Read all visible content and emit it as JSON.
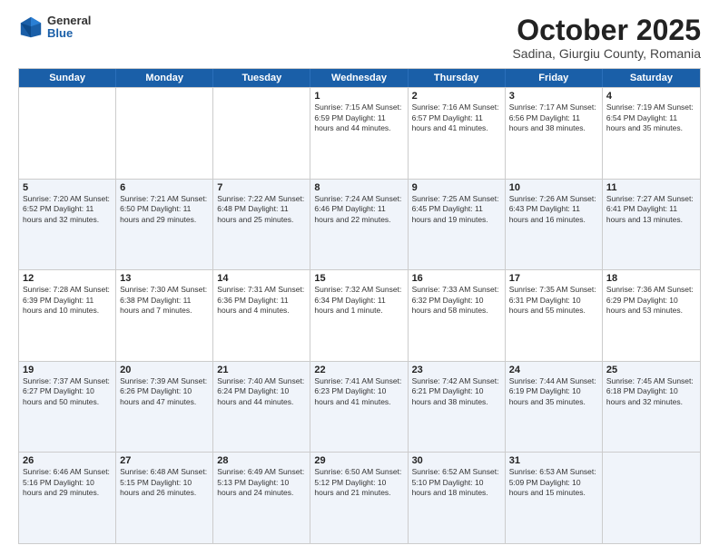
{
  "header": {
    "logo_general": "General",
    "logo_blue": "Blue",
    "month_title": "October 2025",
    "subtitle": "Sadina, Giurgiu County, Romania"
  },
  "weekdays": [
    "Sunday",
    "Monday",
    "Tuesday",
    "Wednesday",
    "Thursday",
    "Friday",
    "Saturday"
  ],
  "rows": [
    [
      {
        "day": "",
        "info": ""
      },
      {
        "day": "",
        "info": ""
      },
      {
        "day": "",
        "info": ""
      },
      {
        "day": "1",
        "info": "Sunrise: 7:15 AM\nSunset: 6:59 PM\nDaylight: 11 hours and 44 minutes."
      },
      {
        "day": "2",
        "info": "Sunrise: 7:16 AM\nSunset: 6:57 PM\nDaylight: 11 hours and 41 minutes."
      },
      {
        "day": "3",
        "info": "Sunrise: 7:17 AM\nSunset: 6:56 PM\nDaylight: 11 hours and 38 minutes."
      },
      {
        "day": "4",
        "info": "Sunrise: 7:19 AM\nSunset: 6:54 PM\nDaylight: 11 hours and 35 minutes."
      }
    ],
    [
      {
        "day": "5",
        "info": "Sunrise: 7:20 AM\nSunset: 6:52 PM\nDaylight: 11 hours and 32 minutes."
      },
      {
        "day": "6",
        "info": "Sunrise: 7:21 AM\nSunset: 6:50 PM\nDaylight: 11 hours and 29 minutes."
      },
      {
        "day": "7",
        "info": "Sunrise: 7:22 AM\nSunset: 6:48 PM\nDaylight: 11 hours and 25 minutes."
      },
      {
        "day": "8",
        "info": "Sunrise: 7:24 AM\nSunset: 6:46 PM\nDaylight: 11 hours and 22 minutes."
      },
      {
        "day": "9",
        "info": "Sunrise: 7:25 AM\nSunset: 6:45 PM\nDaylight: 11 hours and 19 minutes."
      },
      {
        "day": "10",
        "info": "Sunrise: 7:26 AM\nSunset: 6:43 PM\nDaylight: 11 hours and 16 minutes."
      },
      {
        "day": "11",
        "info": "Sunrise: 7:27 AM\nSunset: 6:41 PM\nDaylight: 11 hours and 13 minutes."
      }
    ],
    [
      {
        "day": "12",
        "info": "Sunrise: 7:28 AM\nSunset: 6:39 PM\nDaylight: 11 hours and 10 minutes."
      },
      {
        "day": "13",
        "info": "Sunrise: 7:30 AM\nSunset: 6:38 PM\nDaylight: 11 hours and 7 minutes."
      },
      {
        "day": "14",
        "info": "Sunrise: 7:31 AM\nSunset: 6:36 PM\nDaylight: 11 hours and 4 minutes."
      },
      {
        "day": "15",
        "info": "Sunrise: 7:32 AM\nSunset: 6:34 PM\nDaylight: 11 hours and 1 minute."
      },
      {
        "day": "16",
        "info": "Sunrise: 7:33 AM\nSunset: 6:32 PM\nDaylight: 10 hours and 58 minutes."
      },
      {
        "day": "17",
        "info": "Sunrise: 7:35 AM\nSunset: 6:31 PM\nDaylight: 10 hours and 55 minutes."
      },
      {
        "day": "18",
        "info": "Sunrise: 7:36 AM\nSunset: 6:29 PM\nDaylight: 10 hours and 53 minutes."
      }
    ],
    [
      {
        "day": "19",
        "info": "Sunrise: 7:37 AM\nSunset: 6:27 PM\nDaylight: 10 hours and 50 minutes."
      },
      {
        "day": "20",
        "info": "Sunrise: 7:39 AM\nSunset: 6:26 PM\nDaylight: 10 hours and 47 minutes."
      },
      {
        "day": "21",
        "info": "Sunrise: 7:40 AM\nSunset: 6:24 PM\nDaylight: 10 hours and 44 minutes."
      },
      {
        "day": "22",
        "info": "Sunrise: 7:41 AM\nSunset: 6:23 PM\nDaylight: 10 hours and 41 minutes."
      },
      {
        "day": "23",
        "info": "Sunrise: 7:42 AM\nSunset: 6:21 PM\nDaylight: 10 hours and 38 minutes."
      },
      {
        "day": "24",
        "info": "Sunrise: 7:44 AM\nSunset: 6:19 PM\nDaylight: 10 hours and 35 minutes."
      },
      {
        "day": "25",
        "info": "Sunrise: 7:45 AM\nSunset: 6:18 PM\nDaylight: 10 hours and 32 minutes."
      }
    ],
    [
      {
        "day": "26",
        "info": "Sunrise: 6:46 AM\nSunset: 5:16 PM\nDaylight: 10 hours and 29 minutes."
      },
      {
        "day": "27",
        "info": "Sunrise: 6:48 AM\nSunset: 5:15 PM\nDaylight: 10 hours and 26 minutes."
      },
      {
        "day": "28",
        "info": "Sunrise: 6:49 AM\nSunset: 5:13 PM\nDaylight: 10 hours and 24 minutes."
      },
      {
        "day": "29",
        "info": "Sunrise: 6:50 AM\nSunset: 5:12 PM\nDaylight: 10 hours and 21 minutes."
      },
      {
        "day": "30",
        "info": "Sunrise: 6:52 AM\nSunset: 5:10 PM\nDaylight: 10 hours and 18 minutes."
      },
      {
        "day": "31",
        "info": "Sunrise: 6:53 AM\nSunset: 5:09 PM\nDaylight: 10 hours and 15 minutes."
      },
      {
        "day": "",
        "info": ""
      }
    ]
  ]
}
